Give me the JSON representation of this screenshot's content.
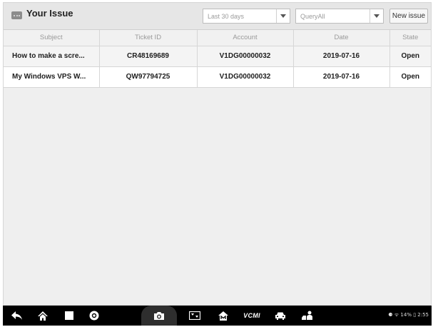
{
  "header": {
    "title": "Your Issue",
    "range_select": "Last 30 days",
    "query_select": "QueryAll",
    "new_issue_label": "New issue"
  },
  "table": {
    "columns": [
      "Subject",
      "Ticket ID",
      "Account",
      "Date",
      "State"
    ],
    "rows": [
      {
        "subject": "How to make a scre...",
        "ticket_id": "CR48169689",
        "account": "V1DG00000032",
        "date": "2019-07-16",
        "state": "Open"
      },
      {
        "subject": "My Windows VPS W...",
        "ticket_id": "QW97794725",
        "account": "V1DG00000032",
        "date": "2019-07-16",
        "state": "Open"
      }
    ]
  },
  "navbar": {
    "items": [
      "back-icon",
      "home-icon",
      "recent-apps-icon",
      "browser-icon",
      "camera-icon",
      "display-icon",
      "maxifix-icon",
      "vcmi-icon",
      "car-icon",
      "technician-icon"
    ],
    "vcm_label": "VCMI",
    "status_text": "⚈ ᯤ 14% ▯ 2:55"
  },
  "colors": {
    "header_bg": "#e6e6e6",
    "page_bg": "#efefef",
    "navbar_bg": "#000000"
  }
}
